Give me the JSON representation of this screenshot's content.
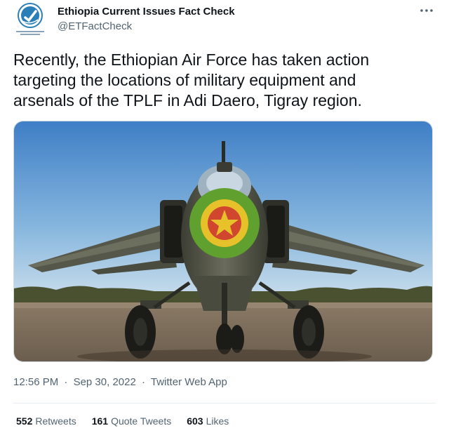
{
  "author": {
    "display_name": "Ethiopia Current Issues Fact Check",
    "handle": "@ETFactCheck"
  },
  "tweet": {
    "text": "Recently, the Ethiopian Air Force has taken action\ntargeting the locations of military equipment and\narsenals of the TPLF in Adi Daero, Tigray region."
  },
  "meta": {
    "time": "12:56 PM",
    "date": "Sep 30, 2022",
    "source": "Twitter Web App",
    "separator": "·"
  },
  "stats": {
    "retweets_count": "552",
    "retweets_label": "Retweets",
    "quotes_count": "161",
    "quotes_label": "Quote Tweets",
    "likes_count": "603",
    "likes_label": "Likes"
  },
  "icons": {
    "more": "more-options-icon",
    "avatar": "fact-check-logo"
  },
  "colors": {
    "text": "#0f1419",
    "secondary": "#536471",
    "border": "#cfd9de",
    "logo_blue": "#2a7fb8"
  }
}
